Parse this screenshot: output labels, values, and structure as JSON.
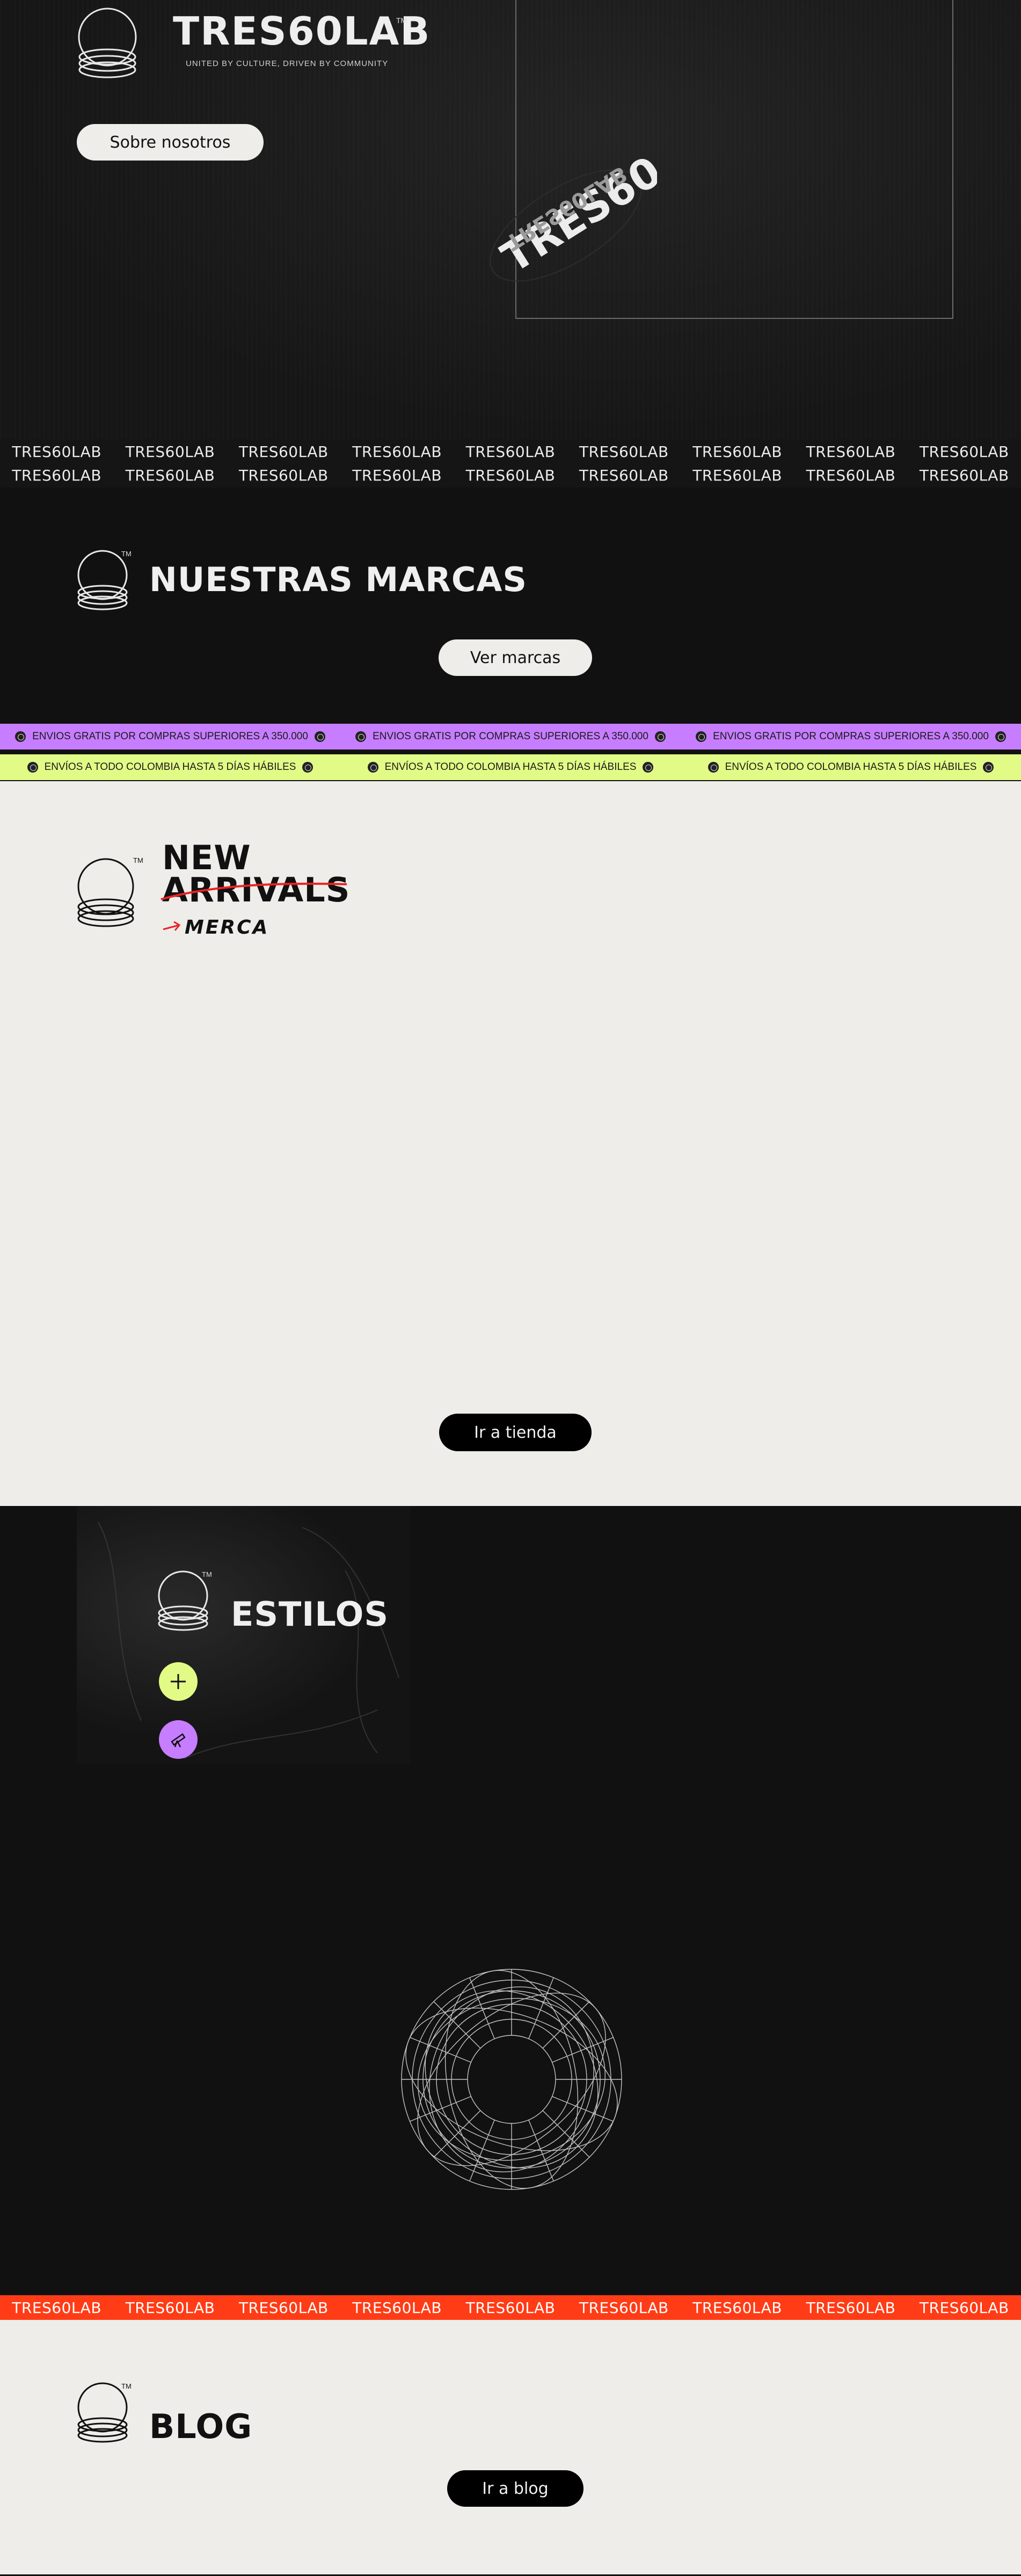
{
  "hero": {
    "brand": "TRES60LAB",
    "tm": "TM",
    "tagline": "UNITED BY CULTURE, DRIVEN BY COMMUNITY",
    "about_button": "Sobre nosotros",
    "badge_text": "TRES60 L"
  },
  "ticker": {
    "label": "TRES60LAB",
    "items": [
      "TRES60LAB",
      "TRES60LAB",
      "TRES60LAB",
      "TRES60LAB",
      "TRES60LAB",
      "TRES60LAB",
      "TRES60LAB",
      "TRES60LAB",
      "TRES60LAB"
    ]
  },
  "marcas": {
    "title": "NUESTRAS MARCAS",
    "tm": "TM",
    "button": "Ver marcas"
  },
  "shipping_strip": {
    "text": "ENVIOS GRATIS POR COMPRAS SUPERIORES A 350.000",
    "color": "#c77dff"
  },
  "colombia_strip": {
    "text": "ENVÍOS A TODO COLOMBIA HASTA 5 DÍAS HÁBILES",
    "color": "#e2fb86"
  },
  "new_arrivals": {
    "line1": "NEW",
    "line2": "ARRIVALS",
    "sub": "MERCA",
    "tm": "TM",
    "button": "Ir a tienda"
  },
  "estilos": {
    "title": "ESTILOS",
    "tm": "TM",
    "plus_color": "#e2fb86",
    "explore_color": "#c77dff"
  },
  "red_ticker": {
    "color": "#ff3c16",
    "items": [
      "TRES60LAB",
      "TRES60LAB",
      "TRES60LAB",
      "TRES60LAB",
      "TRES60LAB",
      "TRES60LAB",
      "TRES60LAB",
      "TRES60LAB",
      "TRES60LAB"
    ]
  },
  "blog": {
    "title": "BLOG",
    "tm": "TM",
    "button": "Ir a blog"
  }
}
